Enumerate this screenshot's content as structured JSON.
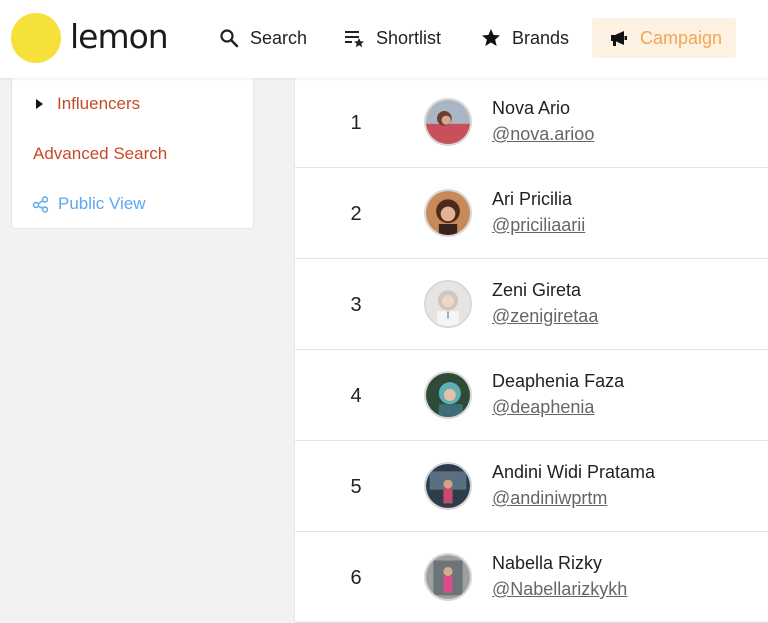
{
  "brand": {
    "name": "lemon",
    "color": "#f6e03a"
  },
  "nav": {
    "items": [
      {
        "label": "Search",
        "icon": "search-icon"
      },
      {
        "label": "Shortlist",
        "icon": "shortlist-icon"
      },
      {
        "label": "Brands",
        "icon": "star-icon"
      },
      {
        "label": "Campaign",
        "icon": "megaphone-icon",
        "active": true
      }
    ],
    "active_color": "#f5a552"
  },
  "sidebar": {
    "influencers_label": "Influencers",
    "advanced_search_label": "Advanced Search",
    "public_view_label": "Public View"
  },
  "list": {
    "rows": [
      {
        "rank": "1",
        "name": "Nova Ario",
        "handle": "@nova.arioo"
      },
      {
        "rank": "2",
        "name": "Ari Pricilia",
        "handle": "@priciliaarii"
      },
      {
        "rank": "3",
        "name": "Zeni Gireta",
        "handle": "@zenigiretaa"
      },
      {
        "rank": "4",
        "name": "Deaphenia Faza",
        "handle": "@deaphenia"
      },
      {
        "rank": "5",
        "name": "Andini Widi Pratama",
        "handle": "@andiniwprtm"
      },
      {
        "rank": "6",
        "name": "Nabella Rizky",
        "handle": "@Nabellarizkykh"
      }
    ]
  }
}
